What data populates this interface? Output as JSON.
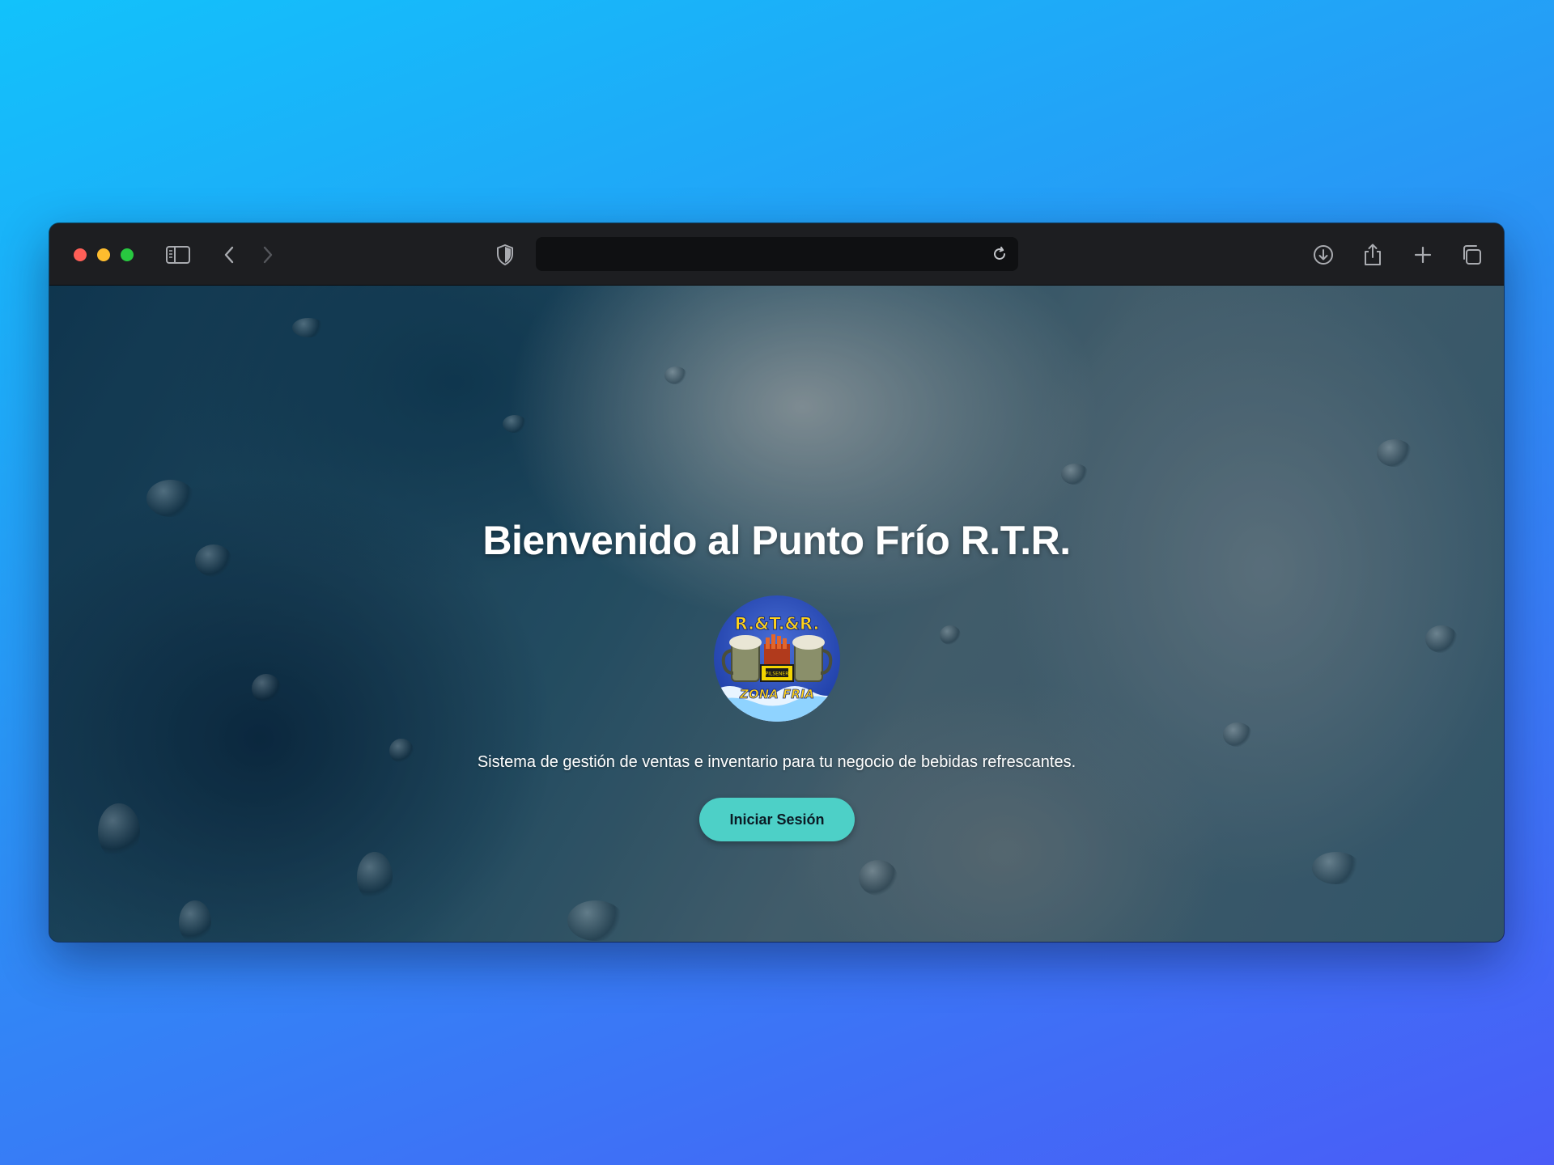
{
  "browser": {
    "url": "",
    "icons": [
      "sidebar-icon",
      "back-icon",
      "forward-icon",
      "shield-icon",
      "reload-icon",
      "download-icon",
      "share-icon",
      "new-tab-icon",
      "tabs-overview-icon"
    ]
  },
  "page": {
    "title": "Bienvenido al Punto Frío R.T.R.",
    "logo": {
      "top_text": "R.&T.&R.",
      "bottom_text": "ZONA FRIA",
      "badge_text": "PILSENER"
    },
    "description": "Sistema de gestión de ventas e inventario para tu negocio de bebidas refrescantes.",
    "login_button": "Iniciar Sesión"
  },
  "colors": {
    "accent": "#4dd0c7",
    "toolbar": "#1d1e21",
    "traffic_red": "#fe5f57",
    "traffic_yellow": "#febc2e",
    "traffic_green": "#28c840"
  }
}
